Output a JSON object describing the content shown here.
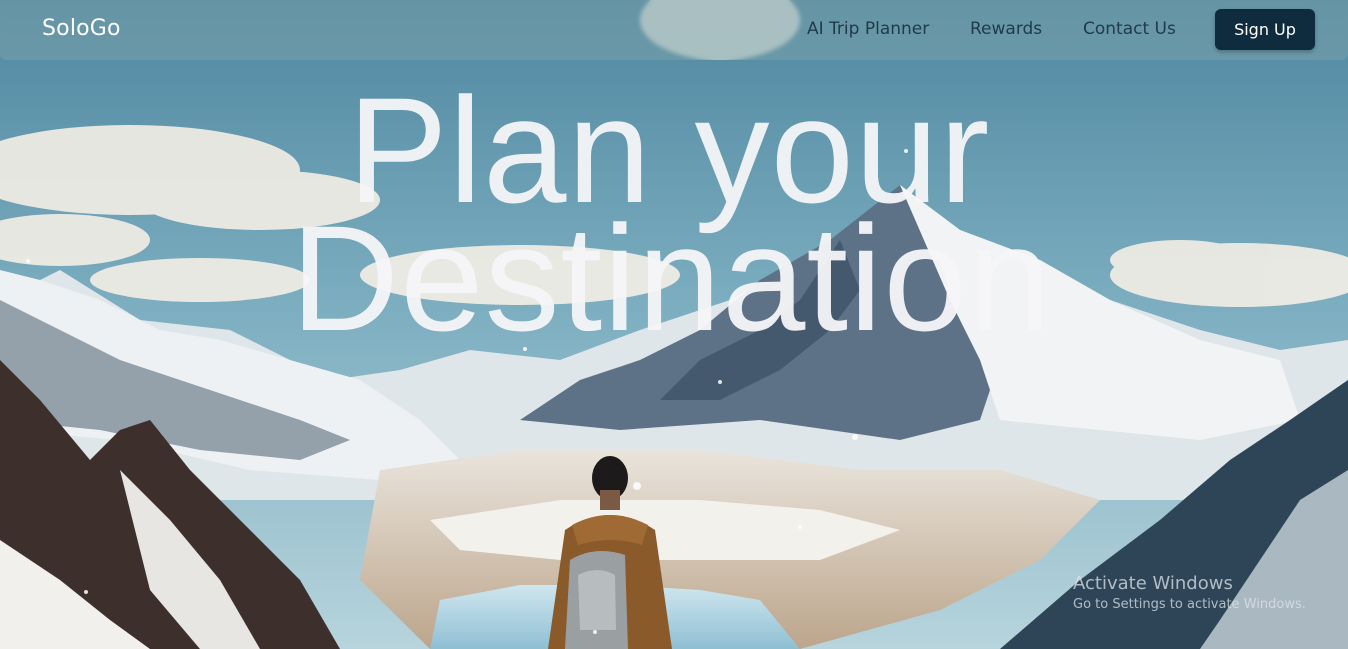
{
  "brand": "SoloGo",
  "nav": {
    "items": [
      "AI Trip Planner",
      "Rewards",
      "Contact Us"
    ],
    "signup_label": "Sign Up"
  },
  "hero": {
    "title_line1": "Plan your",
    "title_line2": "Destination",
    "background": "illustrated snowy mountain valley with hiker carrying backpack, viewed from behind"
  },
  "watermark": {
    "title": "Activate Windows",
    "subtitle": "Go to Settings to activate Windows."
  },
  "colors": {
    "signup_bg": "#0e2c3d",
    "nav_text": "#1f3b4a",
    "sky": "#5a8fa6",
    "headline": "#f5f6f8"
  }
}
